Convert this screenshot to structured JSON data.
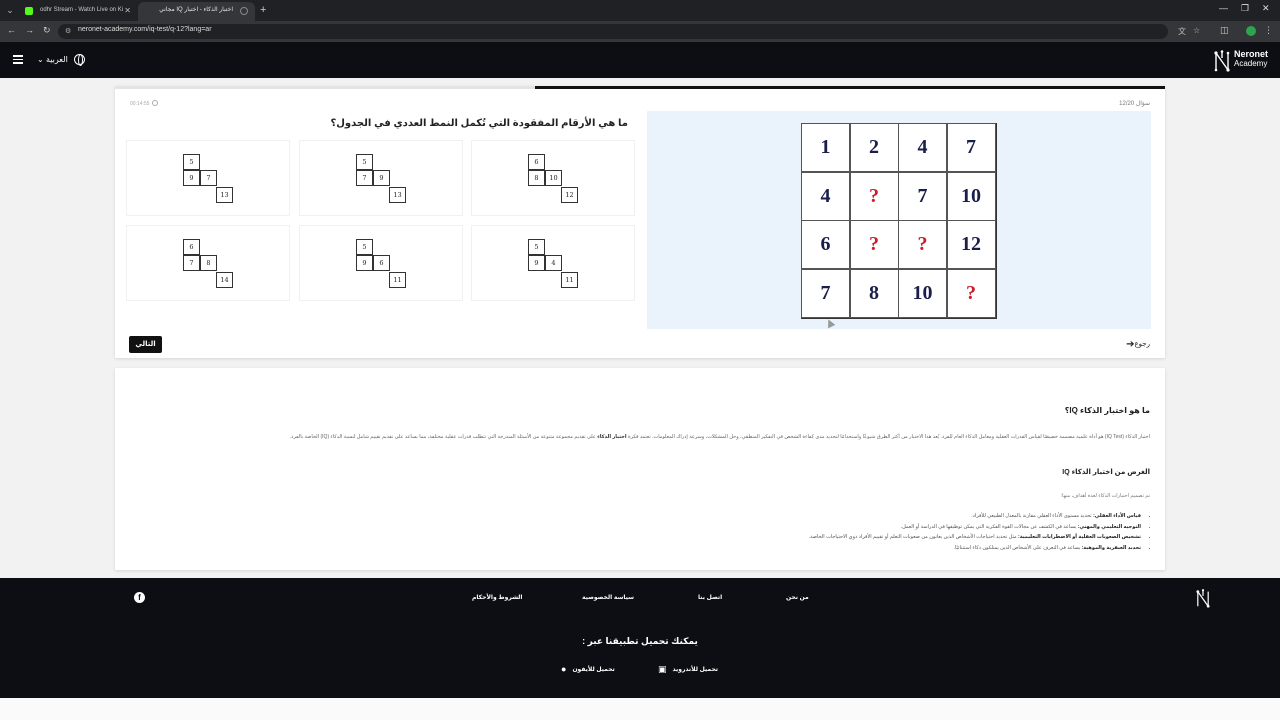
{
  "browser": {
    "tabs": [
      {
        "title": "odhr Stream - Watch Live on Ki"
      },
      {
        "title": "اختبار الذكاء - اختبار IQ مجاني"
      }
    ],
    "url": "neronet-academy.com/iq-test/q-12?lang=ar"
  },
  "header": {
    "language_label": "العربية",
    "logo_line1": "Neronet",
    "logo_line2": "Academy"
  },
  "quiz": {
    "question_counter": "سؤال 12/20",
    "timer": "00:14:55",
    "progress_fraction": 0.6,
    "question": "ما هي الأرقام المفقودة التي تُكمل النمط العددي في الجدول؟",
    "main_grid": [
      [
        "1",
        "2",
        "4",
        "7"
      ],
      [
        "4",
        "?",
        "7",
        "10"
      ],
      [
        "6",
        "?",
        "?",
        "12"
      ],
      [
        "7",
        "8",
        "10",
        "?"
      ]
    ],
    "options": [
      {
        "top": "6",
        "mid_left": "8",
        "mid_right": "10",
        "bottom": "12"
      },
      {
        "top": "5",
        "mid_left": "7",
        "mid_right": "9",
        "bottom": "13"
      },
      {
        "top": "5",
        "mid_left": "9",
        "mid_right": "7",
        "bottom": "13"
      },
      {
        "top": "5",
        "mid_left": "9",
        "mid_right": "4",
        "bottom": "11"
      },
      {
        "top": "5",
        "mid_left": "9",
        "mid_right": "6",
        "bottom": "11"
      },
      {
        "top": "6",
        "mid_left": "7",
        "mid_right": "8",
        "bottom": "14"
      }
    ],
    "next_label": "التالي",
    "back_label": "رجوع"
  },
  "info": {
    "title": "ما هو اختبار الذكاء IQ؟",
    "paragraph_pre": "اختبار الذكاء (IQ Test) هو أداة علمية مصممة خصيصًا لقياس القدرات العقلية ومعامل الذكاء العام للفرد. يُعد هذا الاختبار من أكثر الطرق شيوعًا واستخدامًا لتحديد مدى كفاءة الشخص في التفكير المنطقي، وحل المشكلات، وسرعة إدراك المعلومات. تعتمد فكرة ",
    "paragraph_bold": "اختبار الذكاء",
    "paragraph_post": " على تقديم مجموعة متنوعة من الأسئلة المتدرجة التي تتطلب قدرات عقلية مختلفة، مما يساعد على تقديم تقييم شامل لنسبة الذكاء (IQ) الخاصة بالفرد.",
    "subtitle": "الغرض من اختبار الذكاء IQ",
    "intro": "تم تصميم اختبارات الذكاء لعدة أهداف، منها:",
    "bullets": [
      {
        "bold": "قياس الأداء العقلي:",
        "text": " تحديد مستوى الأداء العقلي مقارنة بالمعدل الطبيعي للأفراد."
      },
      {
        "bold": "التوجيه التعليمي والمهني:",
        "text": " يساعد في الكشف عن مجالات القوة الفكرية التي يمكن توظيفها في الدراسة أو العمل."
      },
      {
        "bold": "تشخيص الصعوبات العقلية أو الاضطرابات التعليمية:",
        "text": " مثل تحديد احتياجات الأشخاص الذين يعانون من صعوبات التعلم أو تقييم الأفراد ذوي الاحتياجات الخاصة."
      },
      {
        "bold": "تحديد العبقرية والموهبة:",
        "text": " يساعد في التعرف على الأشخاص الذين يمتلكون ذكاء استثنائيًا."
      }
    ]
  },
  "footer": {
    "links": [
      "من نحن",
      "اتصل بنا",
      "سياسة الخصوصية",
      "الشروط والأحكام"
    ],
    "app_title": "يمكنك تحميل تطبيقنا عبر :",
    "android_label": "تحميل للأندرويد",
    "ios_label": "تحميل للأيفون"
  }
}
